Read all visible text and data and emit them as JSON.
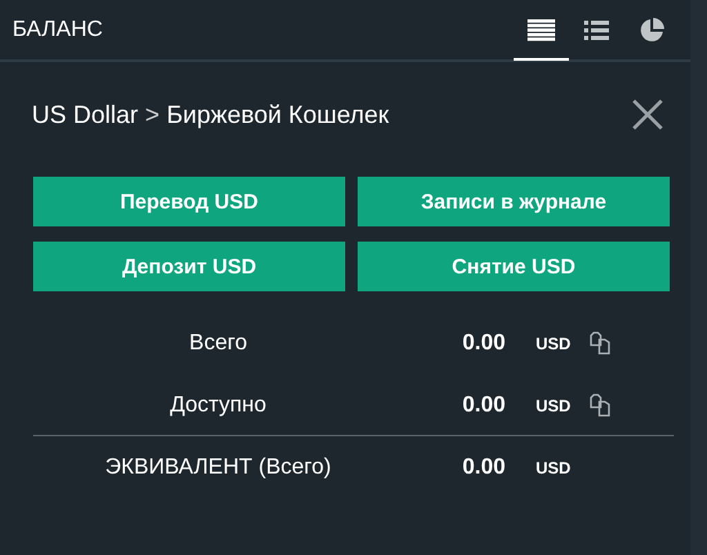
{
  "header": {
    "title": "БАЛАНС",
    "tabs": [
      {
        "selected": true
      },
      {
        "selected": false
      },
      {
        "selected": false
      }
    ]
  },
  "breadcrumb": {
    "currency": "US Dollar",
    "separator": ">",
    "wallet": "Биржевой Кошелек"
  },
  "buttons": [
    "Перевод USD",
    "Записи в журнале",
    "Депозит USD",
    "Снятие USD"
  ],
  "rows": [
    {
      "label": "Всего",
      "value": "0.00",
      "unit": "USD",
      "copyable": true,
      "divider_before": false
    },
    {
      "label": "Доступно",
      "value": "0.00",
      "unit": "USD",
      "copyable": true,
      "divider_before": false
    },
    {
      "label": "ЭКВИВАЛЕНТ (Всего)",
      "value": "0.00",
      "unit": "USD",
      "copyable": false,
      "divider_before": true
    }
  ]
}
